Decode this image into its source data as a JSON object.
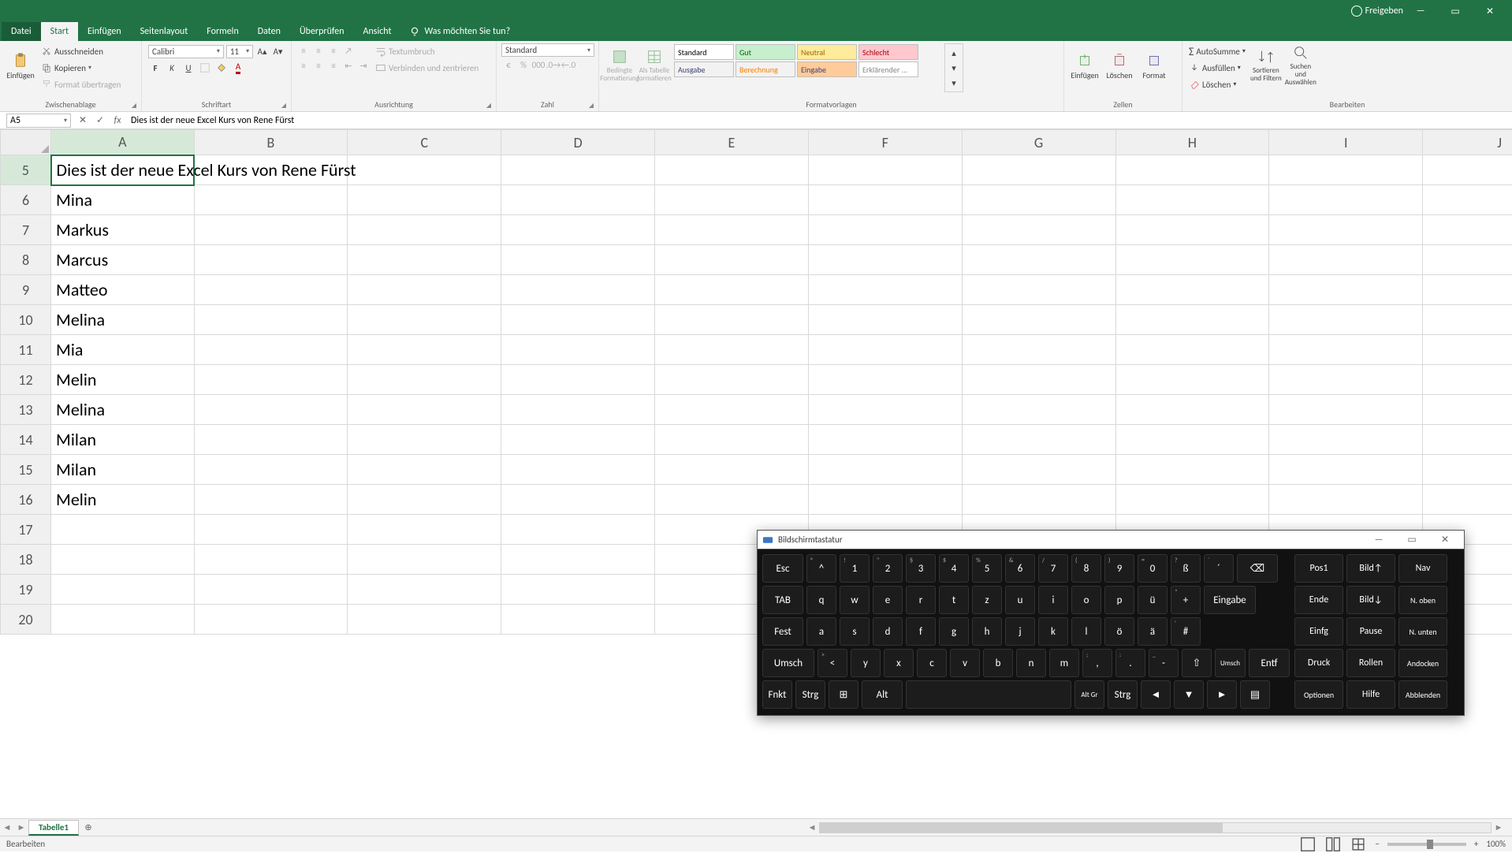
{
  "titlebar": {
    "share": "Freigeben"
  },
  "menu": {
    "file": "Datei",
    "tabs": [
      "Start",
      "Einfügen",
      "Seitenlayout",
      "Formeln",
      "Daten",
      "Überprüfen",
      "Ansicht"
    ],
    "active_index": 0,
    "help_placeholder": "Was möchten Sie tun?"
  },
  "ribbon": {
    "clipboard": {
      "label": "Zwischenablage",
      "paste": "Einfügen",
      "cut": "Ausschneiden",
      "copy": "Kopieren",
      "format_painter": "Format übertragen"
    },
    "font": {
      "label": "Schriftart",
      "name": "Calibri",
      "size": "11"
    },
    "alignment": {
      "label": "Ausrichtung",
      "wrap": "Textumbruch",
      "merge": "Verbinden und zentrieren"
    },
    "number": {
      "label": "Zahl",
      "format": "Standard"
    },
    "styles": {
      "label": "Formatvorlagen",
      "cond": "Bedingte Formatierung",
      "table": "Als Tabelle formatieren",
      "cells": [
        "Standard",
        "Gut",
        "Neutral",
        "Schlecht",
        "Ausgabe",
        "Berechnung",
        "Eingabe",
        "Erklärender ..."
      ]
    },
    "cells": {
      "label": "Zellen",
      "insert": "Einfügen",
      "delete": "Löschen",
      "format": "Format"
    },
    "editing": {
      "label": "Bearbeiten",
      "autosum": "AutoSumme",
      "fill": "Ausfüllen",
      "clear": "Löschen",
      "sort": "Sortieren und Filtern",
      "find": "Suchen und Auswählen"
    }
  },
  "formula_bar": {
    "cell_ref": "A5",
    "content": "Dies ist der neue Excel Kurs von Rene Fürst"
  },
  "columns": [
    "A",
    "B",
    "C",
    "D",
    "E",
    "F",
    "G",
    "H",
    "I",
    "J"
  ],
  "rows": [
    {
      "n": 5,
      "a": "Dies ist der neue Excel Kurs von Rene Fürst",
      "sel": true
    },
    {
      "n": 6,
      "a": "Mina"
    },
    {
      "n": 7,
      "a": "Markus"
    },
    {
      "n": 8,
      "a": "Marcus"
    },
    {
      "n": 9,
      "a": "Matteo"
    },
    {
      "n": 10,
      "a": "Melina"
    },
    {
      "n": 11,
      "a": "Mia"
    },
    {
      "n": 12,
      "a": "Melin"
    },
    {
      "n": 13,
      "a": "Melina"
    },
    {
      "n": 14,
      "a": "Milan"
    },
    {
      "n": 15,
      "a": "Milan"
    },
    {
      "n": 16,
      "a": "Melin"
    },
    {
      "n": 17,
      "a": ""
    },
    {
      "n": 18,
      "a": ""
    },
    {
      "n": 19,
      "a": ""
    },
    {
      "n": 20,
      "a": ""
    }
  ],
  "sheetbar": {
    "sheet": "Tabelle1"
  },
  "statusbar": {
    "mode": "Bearbeiten",
    "zoom": "100%"
  },
  "osk": {
    "title": "Bildschirmtastatur",
    "r1": [
      {
        "l": "Esc",
        "w": "wide1"
      },
      {
        "l": "^",
        "s": "°"
      },
      {
        "l": "1",
        "s": "!"
      },
      {
        "l": "2",
        "s": "\""
      },
      {
        "l": "3",
        "s": "§"
      },
      {
        "l": "4",
        "s": "$"
      },
      {
        "l": "5",
        "s": "%"
      },
      {
        "l": "6",
        "s": "&"
      },
      {
        "l": "7",
        "s": "/"
      },
      {
        "l": "8",
        "s": "("
      },
      {
        "l": "9",
        "s": ")"
      },
      {
        "l": "0",
        "s": "="
      },
      {
        "l": "ß",
        "s": "?"
      },
      {
        "l": "´",
        "s": "`"
      },
      {
        "l": "⌫",
        "w": "wide1"
      }
    ],
    "r2": [
      {
        "l": "TAB",
        "w": "wide1"
      },
      {
        "l": "q"
      },
      {
        "l": "w"
      },
      {
        "l": "e"
      },
      {
        "l": "r"
      },
      {
        "l": "t"
      },
      {
        "l": "z"
      },
      {
        "l": "u"
      },
      {
        "l": "i"
      },
      {
        "l": "o"
      },
      {
        "l": "p"
      },
      {
        "l": "ü"
      },
      {
        "l": "+",
        "s": "*"
      },
      {
        "l": "Eingabe",
        "w": "wide2"
      }
    ],
    "r3": [
      {
        "l": "Fest",
        "w": "wide1"
      },
      {
        "l": "a"
      },
      {
        "l": "s"
      },
      {
        "l": "d"
      },
      {
        "l": "f"
      },
      {
        "l": "g"
      },
      {
        "l": "h"
      },
      {
        "l": "j"
      },
      {
        "l": "k"
      },
      {
        "l": "l"
      },
      {
        "l": "ö"
      },
      {
        "l": "ä"
      },
      {
        "l": "#",
        "s": "'"
      }
    ],
    "r4": [
      {
        "l": "Umsch",
        "w": "wide2"
      },
      {
        "l": "<",
        "s": ">"
      },
      {
        "l": "y"
      },
      {
        "l": "x"
      },
      {
        "l": "c"
      },
      {
        "l": "v"
      },
      {
        "l": "b"
      },
      {
        "l": "n"
      },
      {
        "l": "m"
      },
      {
        "l": ",",
        "s": ";"
      },
      {
        "l": ".",
        "s": ":"
      },
      {
        "l": "-",
        "s": "_"
      },
      {
        "l": "⇧"
      },
      {
        "l": "Umsch",
        "sm": true
      },
      {
        "l": "Entf",
        "w": "wide1"
      }
    ],
    "r5": [
      {
        "l": "Fnkt"
      },
      {
        "l": "Strg"
      },
      {
        "l": "⊞"
      },
      {
        "l": "Alt",
        "w": "wide1"
      },
      {
        "l": "",
        "w": "wide4"
      },
      {
        "l": "Alt Gr",
        "sm": true
      },
      {
        "l": "Strg"
      },
      {
        "l": "◄"
      },
      {
        "l": "▼"
      },
      {
        "l": "►"
      },
      {
        "l": "▤"
      }
    ],
    "side": [
      [
        {
          "l": "Pos1"
        },
        {
          "l": "Bild↑"
        },
        {
          "l": "Nav"
        }
      ],
      [
        {
          "l": "Ende"
        },
        {
          "l": "Bild↓"
        },
        {
          "l": "N. oben",
          "sm": true
        }
      ],
      [
        {
          "l": "Einfg"
        },
        {
          "l": "Pause"
        },
        {
          "l": "N. unten",
          "sm": true
        }
      ],
      [
        {
          "l": "Druck"
        },
        {
          "l": "Rollen"
        },
        {
          "l": "Andocken",
          "sm": true
        }
      ],
      [
        {
          "l": "Optionen",
          "sm": true
        },
        {
          "l": "Hilfe"
        },
        {
          "l": "Abblenden",
          "sm": true
        }
      ]
    ]
  }
}
